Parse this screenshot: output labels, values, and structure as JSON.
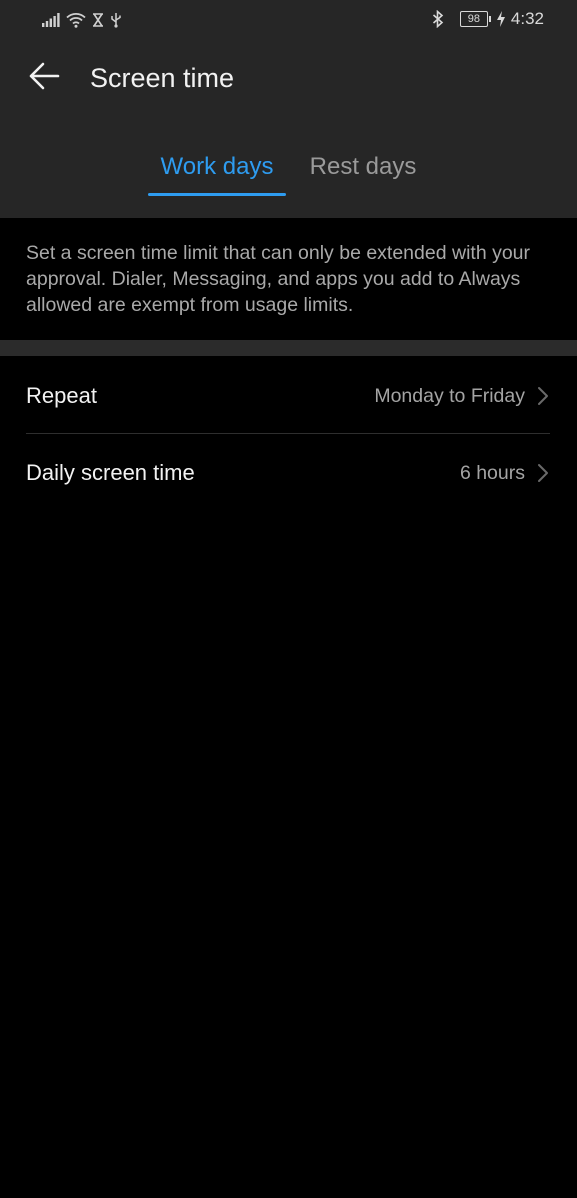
{
  "status_bar": {
    "battery_level": "98",
    "time": "4:32",
    "icons": [
      "signal-icon",
      "wifi-icon",
      "hourglass-icon",
      "usb-icon",
      "bluetooth-icon",
      "battery-icon",
      "charging-icon"
    ]
  },
  "header": {
    "title": "Screen time",
    "back_icon": "arrow-left-icon"
  },
  "tabs": [
    {
      "label": "Work days",
      "selected": true
    },
    {
      "label": "Rest days",
      "selected": false
    }
  ],
  "description": "Set a screen time limit that can only be extended with your approval. Dialer, Messaging, and apps you add to Always allowed are exempt from usage limits.",
  "settings": [
    {
      "label": "Repeat",
      "value": "Monday to Friday"
    },
    {
      "label": "Daily screen time",
      "value": "6 hours"
    }
  ],
  "colors": {
    "accent": "#2e9cf0",
    "header_bg": "#262626",
    "background": "#000000"
  }
}
